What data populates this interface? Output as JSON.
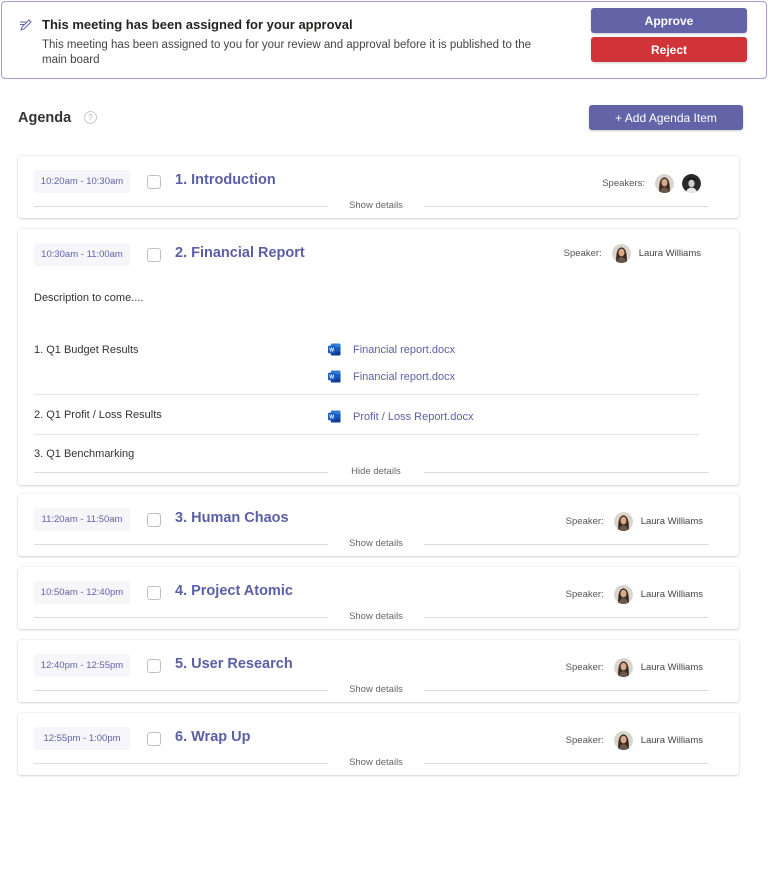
{
  "banner": {
    "icon": "pen-icon",
    "title": "This meeting has been assigned for your approval",
    "description": "This meeting has been assigned to you for your review and approval before it is published to the main board",
    "approve_label": "Approve",
    "reject_label": "Reject"
  },
  "agenda": {
    "title": "Agenda",
    "help_icon": "?",
    "add_button_label": "+ Add Agenda Item",
    "show_details_label": "Show details",
    "hide_details_label": "Hide details",
    "items": [
      {
        "time": "10:20am - 10:30am",
        "title": "1. Introduction",
        "speaker_label": "Speakers:",
        "speakers": [
          "avatar-woman",
          "avatar-man-bw"
        ],
        "speaker_name": "",
        "expanded": false
      },
      {
        "time": "10:30am - 11:00am",
        "title": "2. Financial Report",
        "speaker_label": "Speaker:",
        "speaker_name": "Laura Williams",
        "expanded": true,
        "description": "Description to come....",
        "sub_items": [
          {
            "label": "1. Q1 Budget Results",
            "files": [
              "Financial report.docx",
              "Financial report.docx"
            ]
          },
          {
            "label": "2. Q1 Profit / Loss Results",
            "files": [
              "Profit / Loss Report.docx"
            ]
          },
          {
            "label": "3. Q1 Benchmarking",
            "files": []
          }
        ]
      },
      {
        "time": "11:20am - 11:50am",
        "title": "3. Human Chaos",
        "speaker_label": "Speaker:",
        "speaker_name": "Laura Williams",
        "expanded": false
      },
      {
        "time": "10:50am - 12:40pm",
        "title": "4. Project Atomic",
        "speaker_label": "Speaker:",
        "speaker_name": "Laura Williams",
        "expanded": false
      },
      {
        "time": "12:40pm - 12:55pm",
        "title": "5. User Research",
        "speaker_label": "Speaker:",
        "speaker_name": "Laura Williams",
        "expanded": false
      },
      {
        "time": "12:55pm - 1:00pm",
        "title": "6. Wrap Up",
        "speaker_label": "Speaker:",
        "speaker_name": "Laura Williams",
        "expanded": false
      }
    ]
  },
  "colors": {
    "accent": "#6264a7",
    "danger": "#d13438",
    "title_text": "#5b5fa6",
    "chip_bg": "#f5f5fa",
    "banner_border": "#9ea2d8"
  }
}
